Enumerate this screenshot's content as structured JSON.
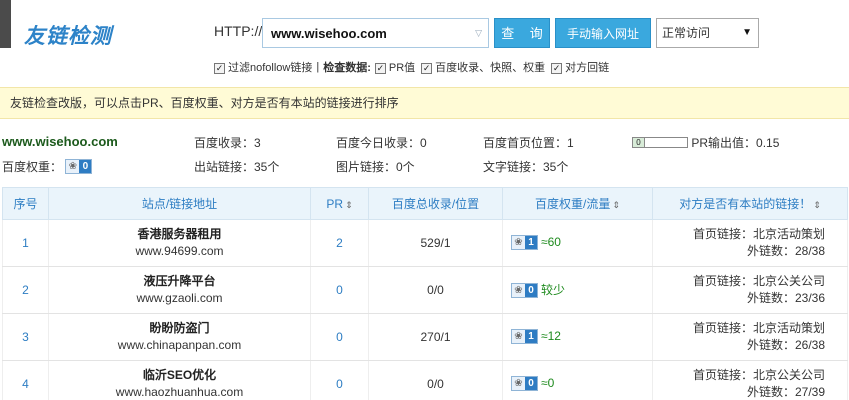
{
  "header": {
    "logo": "友链检测",
    "http_label": "HTTP://",
    "url_value": "www.wisehoo.com",
    "query_button": "查 询",
    "manual_button": "手动输入网址",
    "mode_selected": "正常访问",
    "options": {
      "filter_nofollow": "过滤nofollow链接",
      "separator": "|",
      "check_data_label": "检查数据:",
      "pr_value": "PR值",
      "baidu_index": "百度收录、快照、权重",
      "reciprocal": "对方回链"
    }
  },
  "notice": "友链检查改版，可以点击PR、百度权重、对方是否有本站的链接进行排序",
  "summary": {
    "site": "www.wisehoo.com",
    "baidu_index": "百度收录：3",
    "baidu_today": "百度今日收录：0",
    "baidu_home_pos": "百度首页位置：1",
    "pr_output": "PR输出值：0.15",
    "pr_badge_value": "0",
    "baidu_weight_label": "百度权重：",
    "baidu_weight_value": "0",
    "outbound": "出站链接：35个",
    "image_links": "图片链接：0个",
    "text_links": "文字链接：35个"
  },
  "table": {
    "headers": {
      "index": "序号",
      "site": "站点/链接地址",
      "pr": "PR",
      "total": "百度总收录/位置",
      "weight": "百度权重/流量",
      "has_link": "对方是否有本站的链接！"
    },
    "rows": [
      {
        "index": "1",
        "name": "香港服务器租用",
        "url": "www.94699.com",
        "pr": "2",
        "total": "529/1",
        "weight": "1",
        "flow": "≈60",
        "home_link": "首页链接：北京活动策划",
        "outbound": "外链数：28/38"
      },
      {
        "index": "2",
        "name": "液压升降平台",
        "url": "www.gzaoli.com",
        "pr": "0",
        "total": "0/0",
        "weight": "0",
        "flow": "较少",
        "home_link": "首页链接：北京公关公司",
        "outbound": "外链数：23/36"
      },
      {
        "index": "3",
        "name": "盼盼防盗门",
        "url": "www.chinapanpan.com",
        "pr": "0",
        "total": "270/1",
        "weight": "1",
        "flow": "≈12",
        "home_link": "首页链接：北京活动策划",
        "outbound": "外链数：26/38"
      },
      {
        "index": "4",
        "name": "临沂SEO优化",
        "url": "www.haozhuanhua.com",
        "pr": "0",
        "total": "0/0",
        "weight": "0",
        "flow": "≈0",
        "home_link": "首页链接：北京公关公司",
        "outbound": "外链数：27/39"
      }
    ]
  },
  "colors": {
    "accent": "#2d7dc3",
    "button": "#3aa8de",
    "notice_bg": "#fffbd6",
    "site_green": "#1c5a1c"
  }
}
